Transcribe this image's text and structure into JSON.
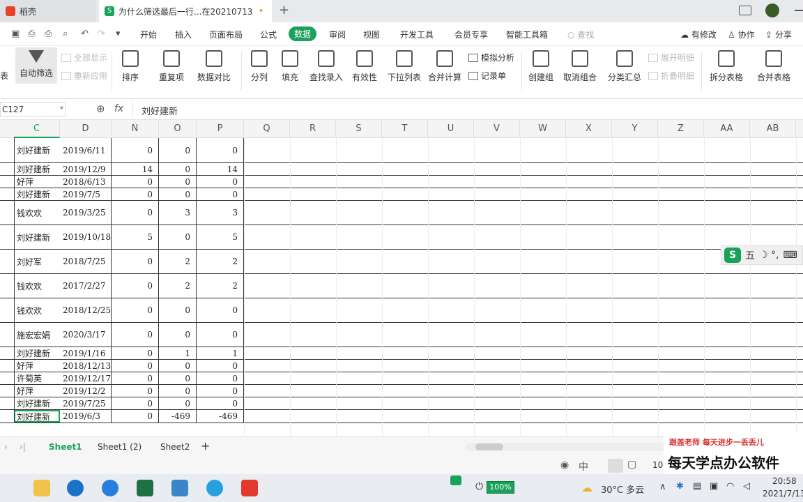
{
  "tabs": [
    {
      "label": "稻壳"
    },
    {
      "label": "为什么筛选最后一行...在20210713",
      "modified": "•"
    }
  ],
  "new_tab": "+",
  "menu": [
    "开始",
    "插入",
    "页面布局",
    "公式",
    "数据",
    "审阅",
    "视图",
    "开发工具",
    "会员专享",
    "智能工具箱"
  ],
  "search_label": "查找",
  "right_actions": [
    "有修改",
    "协作",
    "分享"
  ],
  "ribbon": {
    "left_cut": "表",
    "autofilter": "自动筛选",
    "show_all": "全部显示",
    "reapply": "重新应用",
    "sort": "排序",
    "dup": "重复项",
    "compare": "数据对比",
    "split": "分列",
    "fill": "填充",
    "lookup": "查找录入",
    "validity": "有效性",
    "dropdown": "下拉列表",
    "consolidate": "合并计算",
    "whatif": "模拟分析",
    "record": "记录单",
    "group": "创建组",
    "ungroup": "取消组合",
    "subtotal": "分类汇总",
    "expand": "展开明细",
    "collapse": "折叠明细",
    "split_table": "拆分表格",
    "merge_table": "合并表格"
  },
  "namebox": "C127",
  "fx": "fx",
  "formula": "刘好建新",
  "columns": [
    "C",
    "D",
    "N",
    "O",
    "P",
    "Q",
    "R",
    "S",
    "T",
    "U",
    "V",
    "W",
    "X",
    "Y",
    "Z",
    "AA",
    "AB"
  ],
  "rows": [
    {
      "c": "刘好建新",
      "d": "2019/6/11",
      "n": "0",
      "o": "0",
      "p": "0"
    },
    {
      "c": "刘好建新",
      "d": "2019/12/9",
      "n": "14",
      "o": "0",
      "p": "14"
    },
    {
      "c": "好萍",
      "d": "2018/6/13",
      "n": "0",
      "o": "0",
      "p": "0"
    },
    {
      "c": "刘好建新",
      "d": "2019/7/5",
      "n": "0",
      "o": "0",
      "p": "0"
    },
    {
      "c": "钱欢欢",
      "d": "2019/3/25",
      "n": "0",
      "o": "3",
      "p": "3"
    },
    {
      "c": "刘好建新",
      "d": "2019/10/18",
      "n": "5",
      "o": "0",
      "p": "5"
    },
    {
      "c": "刘好军",
      "d": "2018/7/25",
      "n": "0",
      "o": "2",
      "p": "2"
    },
    {
      "c": "钱欢欢",
      "d": "2017/2/27",
      "n": "0",
      "o": "2",
      "p": "2"
    },
    {
      "c": "钱欢欢",
      "d": "2018/12/25",
      "n": "0",
      "o": "0",
      "p": "0"
    },
    {
      "c": "施宏宏娟",
      "d": "2020/3/17",
      "n": "0",
      "o": "0",
      "p": "0"
    },
    {
      "c": "刘好建新",
      "d": "2019/1/16",
      "n": "0",
      "o": "1",
      "p": "1"
    },
    {
      "c": "好萍",
      "d": "2018/12/13",
      "n": "0",
      "o": "0",
      "p": "0"
    },
    {
      "c": "许菊英",
      "d": "2019/12/17",
      "n": "0",
      "o": "0",
      "p": "0"
    },
    {
      "c": "好萍",
      "d": "2019/12/2",
      "n": "0",
      "o": "0",
      "p": "0"
    },
    {
      "c": "刘好建新",
      "d": "2019/7/25",
      "n": "0",
      "o": "0",
      "p": "0"
    },
    {
      "c": "刘好建新",
      "d": "2019/6/3",
      "n": "0",
      "o": "-469",
      "p": "-469"
    }
  ],
  "sheets": [
    "Sheet1",
    "Sheet1 (2)",
    "Sheet2"
  ],
  "zoom_partial": "10",
  "ime": {
    "label": "五",
    "icons": "☽ °,"
  },
  "watermark": {
    "line1": "跟盖老师  每天进步一丢丢儿",
    "line2": "每天学点办公软件"
  },
  "taskbar": {
    "battery": "100%",
    "weather": "30°C 多云",
    "time": "20:58",
    "date": "2021/7/13"
  }
}
